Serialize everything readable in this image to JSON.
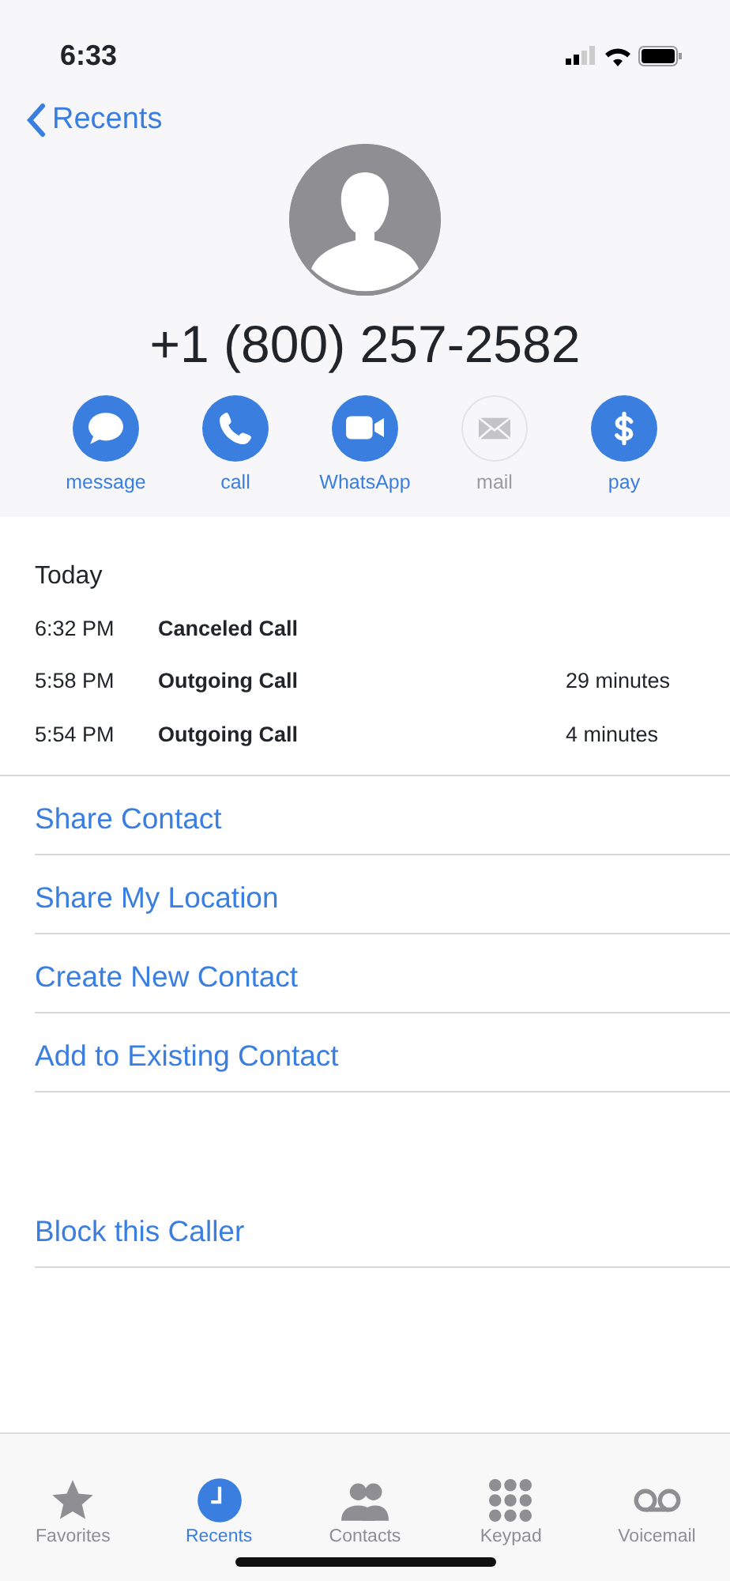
{
  "status_bar": {
    "time": "6:33"
  },
  "nav": {
    "back": "Recents"
  },
  "contact": {
    "number": "+1 (800) 257-2582"
  },
  "actions": [
    {
      "kind": "message",
      "label": "message",
      "disabled": false
    },
    {
      "kind": "call",
      "label": "call",
      "disabled": false
    },
    {
      "kind": "video",
      "label": "WhatsApp",
      "disabled": false
    },
    {
      "kind": "mail",
      "label": "mail",
      "disabled": true
    },
    {
      "kind": "pay",
      "label": "pay",
      "disabled": false
    }
  ],
  "history": {
    "title": "Today",
    "calls": [
      {
        "time": "6:32 PM",
        "type": "Canceled Call"
      },
      {
        "time": "5:58 PM",
        "type": "Outgoing Call",
        "duration": "29 minutes"
      },
      {
        "time": "5:54 PM",
        "type": "Outgoing Call",
        "duration": "4 minutes"
      }
    ]
  },
  "options": [
    "Share Contact",
    "Share My Location",
    "Create New Contact",
    "Add to Existing Contact"
  ],
  "block": "Block this Caller",
  "tabs": [
    {
      "kind": "favorites",
      "label": "Favorites",
      "selected": false
    },
    {
      "kind": "recents",
      "label": "Recents",
      "selected": true
    },
    {
      "kind": "contacts",
      "label": "Contacts",
      "selected": false
    },
    {
      "kind": "keypad",
      "label": "Keypad",
      "selected": false
    },
    {
      "kind": "voicemail",
      "label": "Voicemail",
      "selected": false
    }
  ]
}
